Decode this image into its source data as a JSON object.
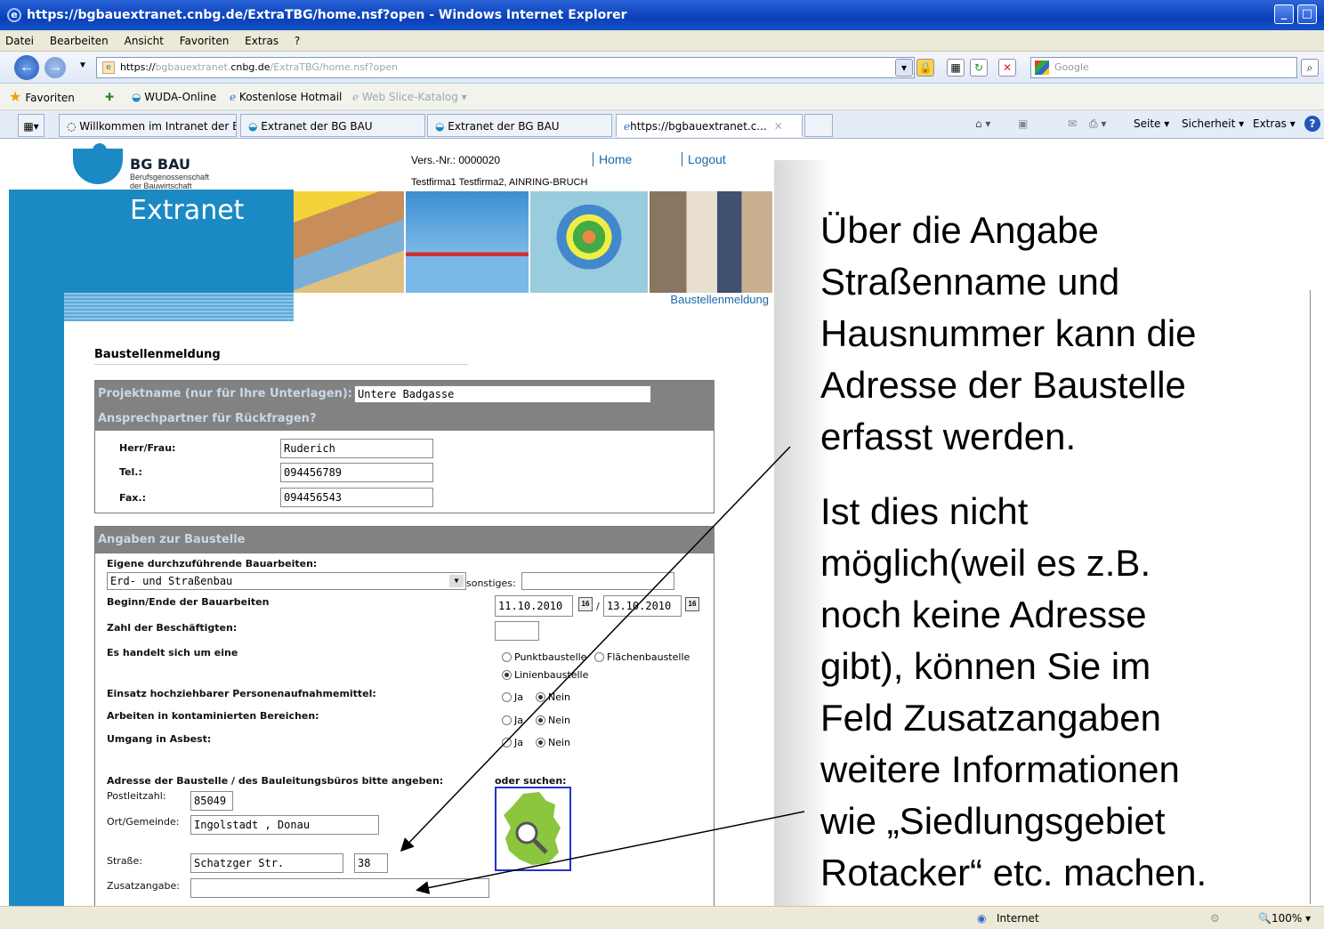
{
  "window": {
    "title": "https://bgbauextranet.cnbg.de/ExtraTBG/home.nsf?open - Windows Internet Explorer"
  },
  "menu": [
    "Datei",
    "Bearbeiten",
    "Ansicht",
    "Favoriten",
    "Extras",
    "?"
  ],
  "address": {
    "prefix": "https://",
    "grey1": "bgbauextranet.",
    "domain": "cnbg.de",
    "rest": "/ExtraTBG/home.nsf?open"
  },
  "search": {
    "placeholder": "Google"
  },
  "favorites": {
    "label": "Favoriten",
    "items": [
      "WUDA-Online",
      "Kostenlose Hotmail",
      "Web Slice-Katalog ▾"
    ]
  },
  "tabs": [
    "Willkommen im Intranet der B...",
    "Extranet der BG BAU",
    "Extranet der BG BAU",
    "https://bgbauextranet.c..."
  ],
  "commands": [
    "Seite ▾",
    "Sicherheit ▾",
    "Extras ▾"
  ],
  "header": {
    "logo_title": "BG BAU",
    "logo_sub1": "Berufsgenossenschaft",
    "logo_sub2": "der Bauwirtschaft",
    "extranet": "Extranet",
    "vers_nr": "Vers.-Nr.: 0000020",
    "home": "Home",
    "logout": "Logout",
    "firma": "Testfirma1 Testfirma2, AINRING-BRUCH",
    "baustellenmeldung_link": "Baustellenmeldung"
  },
  "form": {
    "title": "Baustellenmeldung",
    "projekt_label": "Projektname (nur für Ihre Unterlagen):",
    "projekt_value": "Untere Badgasse",
    "ansprech_header": "Ansprechpartner für Rückfragen?",
    "herr_label": "Herr/Frau:",
    "herr_value": "Ruderich",
    "tel_label": "Tel.:",
    "tel_value": "094456789",
    "fax_label": "Fax.:",
    "fax_value": "094456543",
    "angaben_header": "Angaben zur Baustelle",
    "eigene_label": "Eigene durchzuführende Bauarbeiten:",
    "eigene_value": "Erd- und Straßenbau",
    "sonstiges_label": "sonstiges:",
    "beginn_label": "Beginn/Ende der Bauarbeiten",
    "beginn_value": "11.10.2010",
    "ende_value": "13.10.2010",
    "zahl_label": "Zahl der Beschäftigten:",
    "handelt_label": "Es handelt sich um eine",
    "punkt": "Punktbaustelle",
    "flaechen": "Flächenbaustelle",
    "linien": "Linienbaustelle",
    "einsatz_label": "Einsatz hochziehbarer Personenaufnahmemittel:",
    "kontam_label": "Arbeiten in kontaminierten Bereichen:",
    "asbest_label": "Umgang in Asbest:",
    "ja": "Ja",
    "nein": "Nein",
    "adresse_label": "Adresse der Baustelle / des Bauleitungsbüros bitte angeben:",
    "oder_suchen": "oder suchen:",
    "plz_label": "Postleitzahl:",
    "plz_value": "85049",
    "ort_label": "Ort/Gemeinde:",
    "ort_value": "Ingolstadt , Donau",
    "strasse_label": "Straße:",
    "strasse_value": "Schatzger Str.",
    "hausnr_value": "38",
    "zusatz_label": "Zusatzangabe:"
  },
  "annotation": {
    "p1": [
      "Über die Angabe",
      "Straßenname und",
      "Hausnummer kann die",
      "Adresse der Baustelle",
      "erfasst werden."
    ],
    "p2": [
      "Ist dies nicht",
      "möglich(weil es z.B.",
      "noch keine Adresse",
      "gibt), können Sie im",
      "Feld Zusatzangaben",
      "weitere Informationen",
      "wie „Siedlungsgebiet",
      "Rotacker“ etc. machen."
    ]
  },
  "status": {
    "zone": "Internet",
    "zoom": "100%"
  },
  "colors": {
    "bgbau_blue": "#1b8ac4",
    "form_header_gray": "#828282",
    "title_bar": "#0a3fb8"
  }
}
